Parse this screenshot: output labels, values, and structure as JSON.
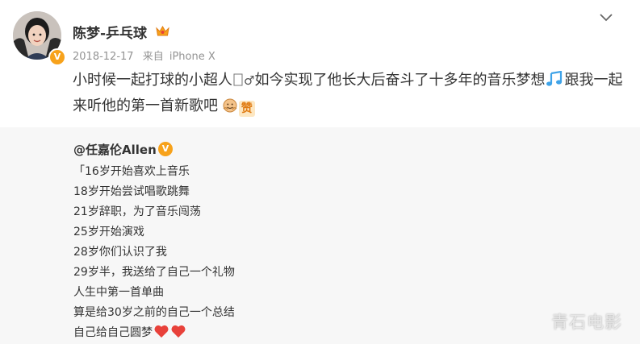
{
  "header": {
    "username": "陈梦-乒乓球",
    "time": "2018-12-17",
    "source_prefix": "来自",
    "source": "iPhone X",
    "verified_icon": "orange-v-badge",
    "member_icon": "vip-crown-icon",
    "more_icon": "chevron-down-icon"
  },
  "post": {
    "line1_a": "小时候一起打球的小超人",
    "gender_glyph": "♂",
    "line1_b": "如今实现了他长大后奋斗了十多年的音乐梦想",
    "line1_c": "跟我一起",
    "line2": "来听他的第一首新歌吧",
    "zan_label": "赞"
  },
  "quote": {
    "author": "@任嘉伦Allen",
    "lines": [
      "「16岁开始喜欢上音乐",
      "18岁开始尝试唱歌跳舞",
      "21岁辞职，为了音乐闯荡",
      "25岁开始演戏",
      "28岁你们认识了我",
      "29岁半，我送给了自己一个礼物",
      "人生中第一首单曲",
      "算是给30岁之前的自己一个总结",
      "自己给自己圆梦"
    ]
  },
  "watermark": "青石电影",
  "colors": {
    "accent_orange": "#f7a21b",
    "heart_red": "#e8413a",
    "music_blue": "#3fa3e8",
    "meta_gray": "#939393",
    "quote_bg": "#f7f7f7"
  }
}
